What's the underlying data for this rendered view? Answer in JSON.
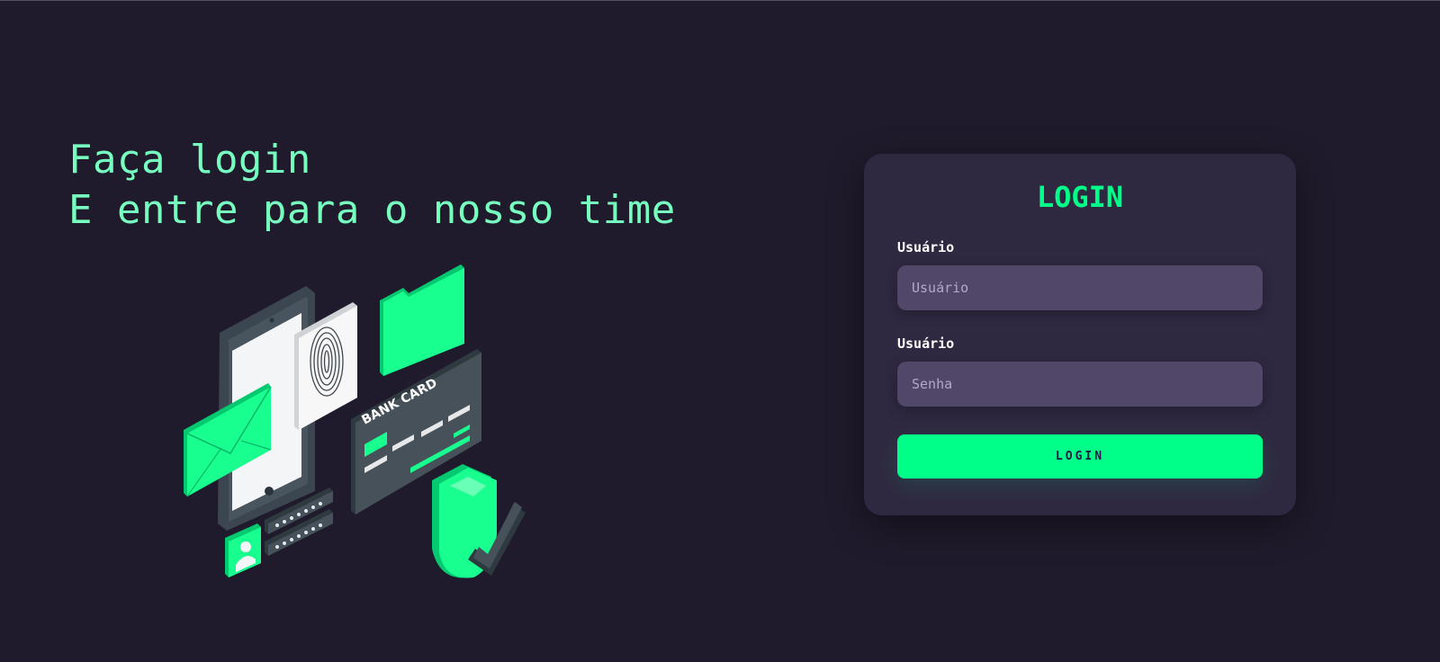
{
  "hero": {
    "line1": "Faça login",
    "line2": "E entre para o nosso time",
    "illustration_card_text": "BANK CARD"
  },
  "login_card": {
    "title": "LOGIN",
    "username_label": "Usuário",
    "username_placeholder": "Usuário",
    "password_label": "Usuário",
    "password_placeholder": "Senha",
    "button_label": "LOGIN"
  },
  "colors": {
    "background": "#201b2c",
    "accent": "#00ff88",
    "headline": "#77ffc0",
    "card": "#2f2841",
    "input": "#514869"
  },
  "icons": [
    "envelope-icon",
    "fingerprint-icon",
    "folder-icon",
    "bank-card-icon",
    "shield-check-icon",
    "user-avatar-icon",
    "password-dots-icon"
  ]
}
